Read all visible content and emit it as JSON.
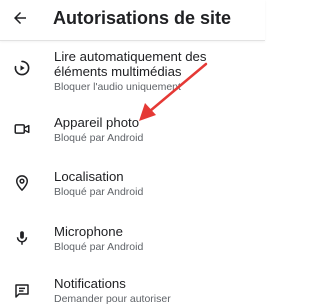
{
  "header": {
    "title": "Autorisations de site",
    "back_icon": "arrow-back-icon"
  },
  "permissions": [
    {
      "title": "Lire automatiquement des éléments multimédias",
      "subtitle": "Bloquer l'audio uniquement",
      "icon": "autoplay-icon"
    },
    {
      "title": "Appareil photo",
      "subtitle": "Bloqué par Android",
      "icon": "camera-icon"
    },
    {
      "title": "Localisation",
      "subtitle": "Bloqué par Android",
      "icon": "location-icon"
    },
    {
      "title": "Microphone",
      "subtitle": "Bloqué par Android",
      "icon": "microphone-icon"
    },
    {
      "title": "Notifications",
      "subtitle": "Demander pour autoriser",
      "icon": "notifications-icon"
    }
  ],
  "annotation": {
    "color": "#e53935"
  }
}
